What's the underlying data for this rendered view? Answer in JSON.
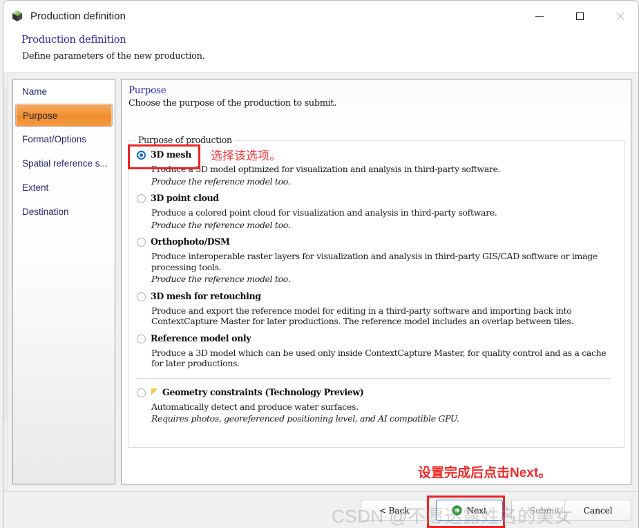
{
  "window": {
    "title": "Production definition",
    "app_icon": "cube-icon",
    "controls": {
      "minimize": "minimize-icon",
      "maximize": "maximize-icon",
      "close": "close-icon"
    }
  },
  "header": {
    "title": "Production definition",
    "subtitle": "Define parameters of the new production."
  },
  "sidebar": {
    "items": [
      {
        "label": "Name",
        "selected": false
      },
      {
        "label": "Purpose",
        "selected": true
      },
      {
        "label": "Format/Options",
        "selected": false
      },
      {
        "label": "Spatial reference s...",
        "selected": false
      },
      {
        "label": "Extent",
        "selected": false
      },
      {
        "label": "Destination",
        "selected": false
      }
    ]
  },
  "main": {
    "title": "Purpose",
    "subtitle": "Choose the purpose of the production to submit.",
    "group_legend": "Purpose of production",
    "options": [
      {
        "label": "3D mesh",
        "checked": true,
        "desc": "Produce a 3D model optimized for visualization and analysis in third-party software.",
        "note": "Produce the reference model too."
      },
      {
        "label": "3D point cloud",
        "checked": false,
        "desc": "Produce a colored point cloud for visualization and analysis in third-party software.",
        "note": "Produce the reference model too."
      },
      {
        "label": "Orthophoto/DSM",
        "checked": false,
        "desc": "Produce interoperable raster layers for visualization and analysis in third-party GIS/CAD software or image processing tools.",
        "note": "Produce the reference model too."
      },
      {
        "label": "3D mesh for retouching",
        "checked": false,
        "desc": "Produce and export the reference model for editing in a third-party software and importing back into ContextCapture Master for later productions. The reference model includes an overlap between tiles.",
        "note": ""
      },
      {
        "label": "Reference model only",
        "checked": false,
        "desc": "Produce a 3D model which can be used only inside ContextCapture Master, for quality control and as a cache for later productions.",
        "note": ""
      },
      {
        "label": "Geometry constraints (Technology Preview)",
        "checked": false,
        "badge": "flag-icon",
        "desc": "Automatically detect and produce water surfaces.",
        "note": "Requires photos, georeferenced positioning level, and AI compatible GPU."
      }
    ]
  },
  "footer": {
    "back": "< Back",
    "next": "Next",
    "submit": "Submit",
    "cancel": "Cancel"
  },
  "annotations": {
    "select_option": "选择该选项。",
    "click_next": "设置完成后点击Next。",
    "watermark": "CSDN @不愿透露姓名的美女"
  },
  "colors": {
    "accent_selected": "#f29339",
    "link_blue": "#2626b0",
    "radio_blue": "#0e6fc4",
    "annotation_red": "#ee2222",
    "next_border": "#2f82d4"
  }
}
